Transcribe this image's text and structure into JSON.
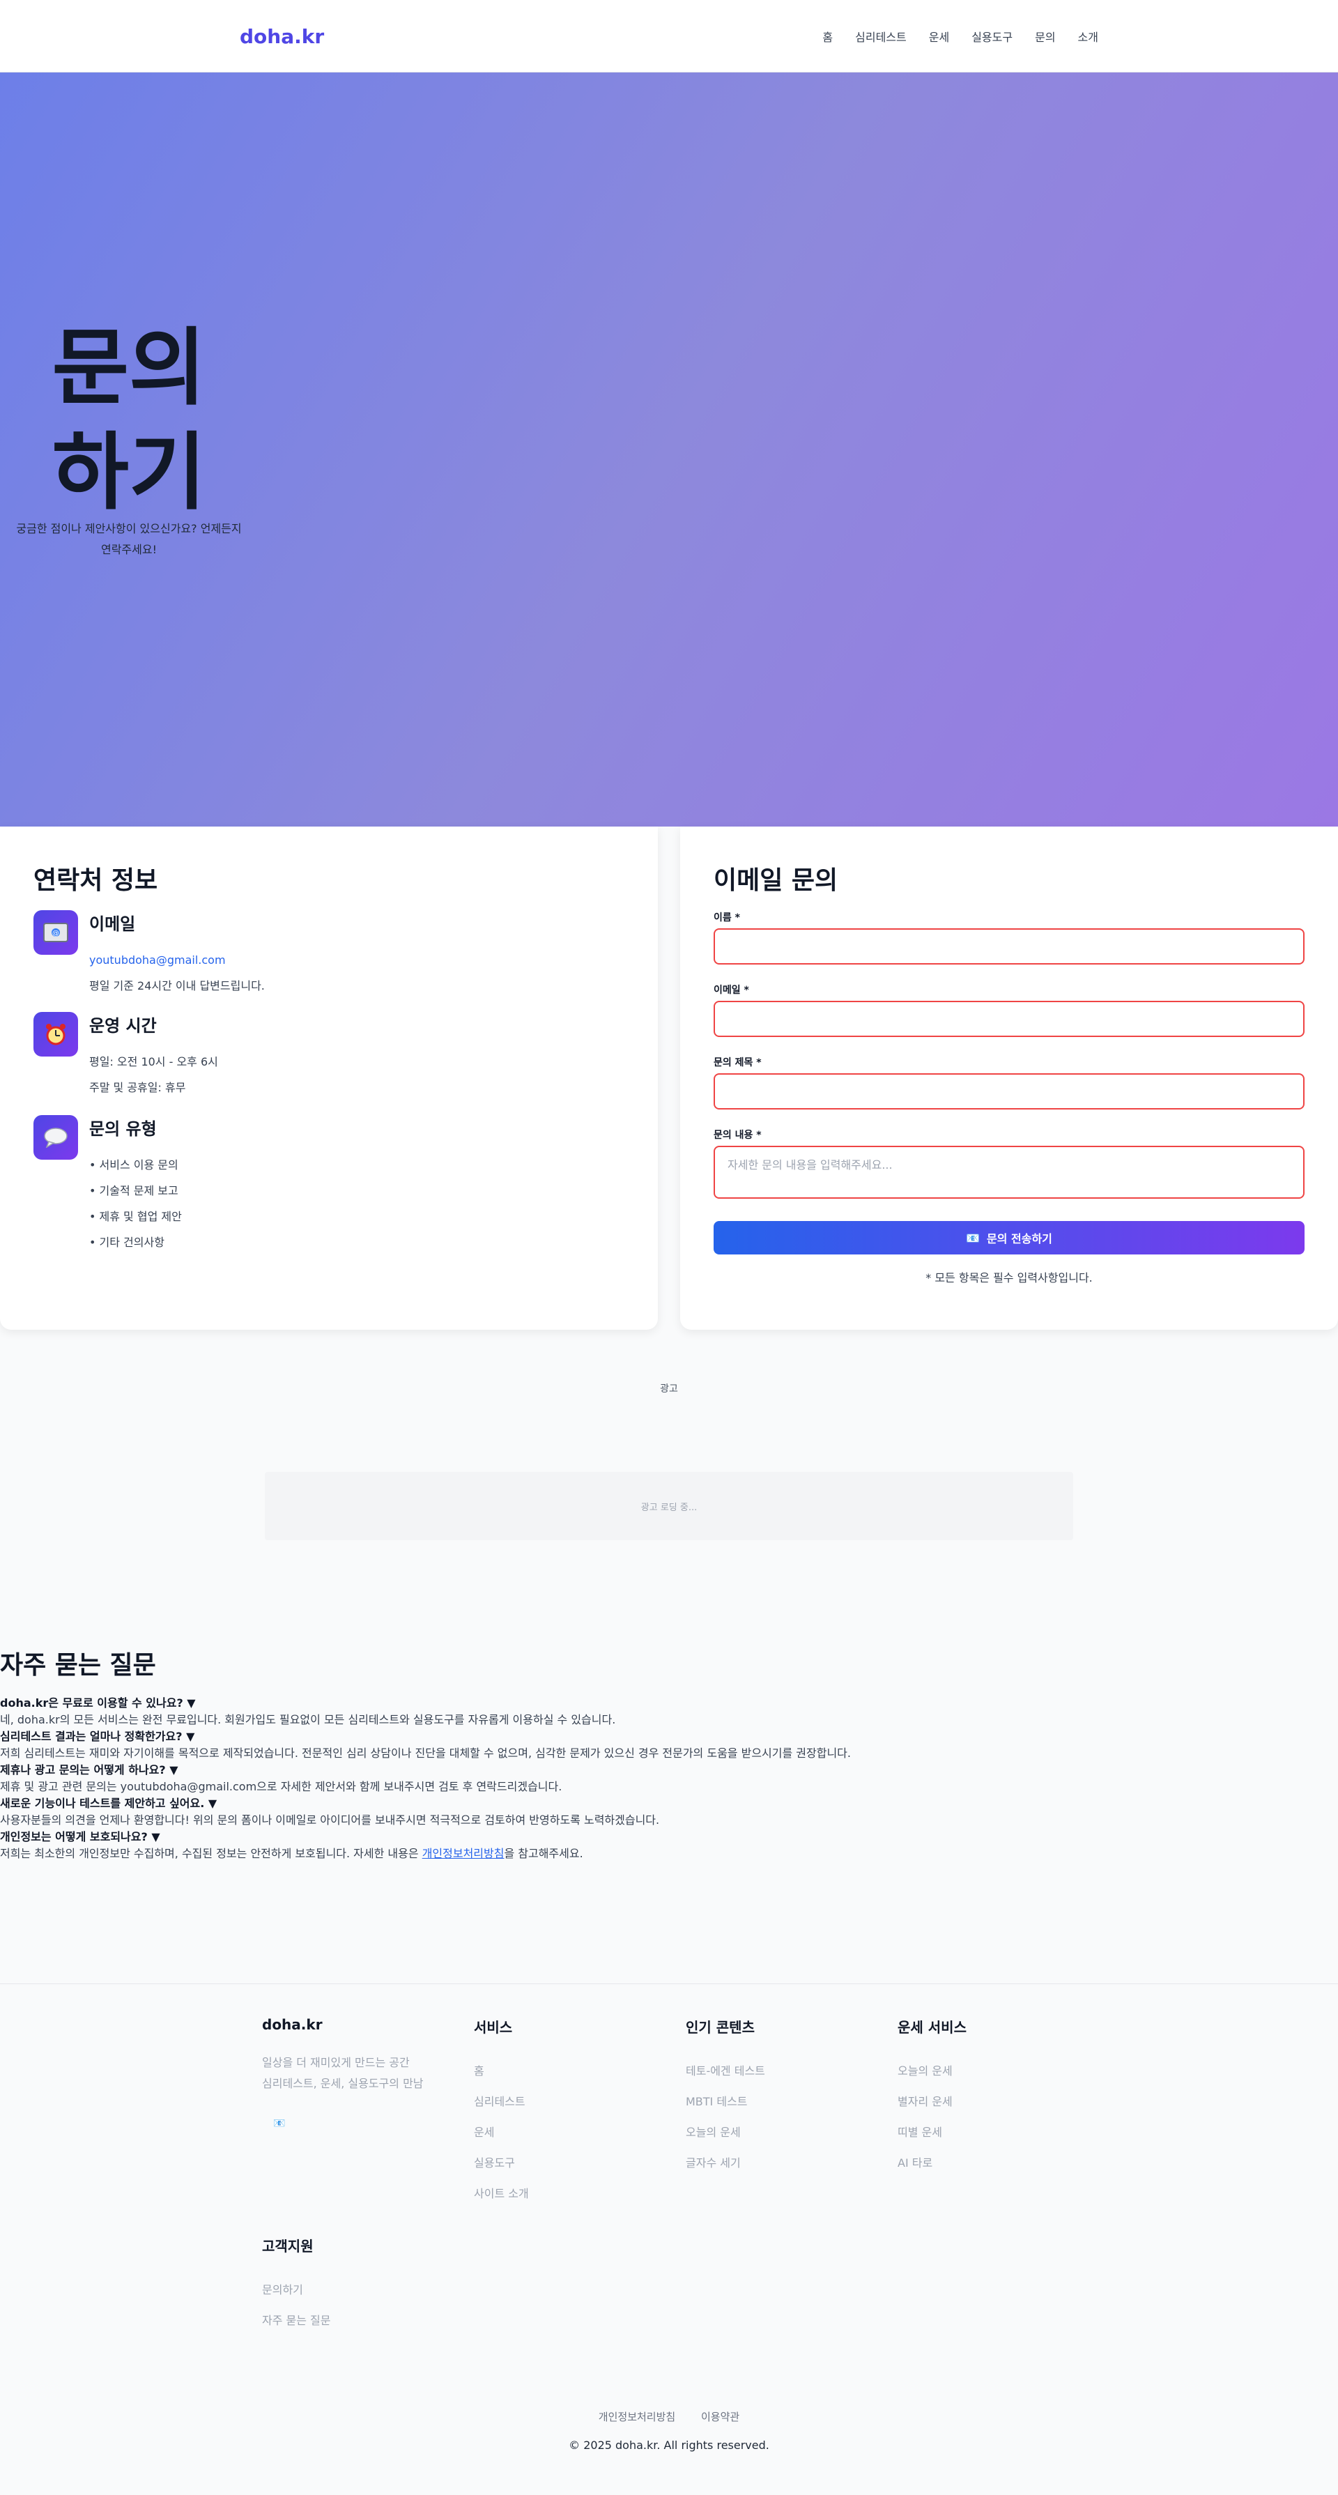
{
  "header": {
    "logo": "doha.kr",
    "nav": [
      "홈",
      "심리테스트",
      "운세",
      "실용도구",
      "문의",
      "소개"
    ]
  },
  "hero": {
    "title": "문의하기",
    "subtitle": "궁금한 점이나 제안사항이 있으신가요? 언제든지 연락주세요!"
  },
  "contact": {
    "heading": "연락처 정보",
    "email": {
      "icon": "email-icon",
      "title": "이메일",
      "address": "youtubdoha@gmail.com",
      "note": "평일 기준 24시간 이내 답변드립니다."
    },
    "hours": {
      "icon": "alarm-clock-icon",
      "title": "운영 시간",
      "weekday": "평일: 오전 10시 - 오후 6시",
      "weekend": "주말 및 공휴일: 휴무"
    },
    "types": {
      "icon": "speech-bubble-icon",
      "title": "문의 유형",
      "items": [
        "• 서비스 이용 문의",
        "• 기술적 문제 보고",
        "• 제휴 및 협업 제안",
        "• 기타 건의사항"
      ]
    }
  },
  "form": {
    "heading": "이메일 문의",
    "name_label": "이름 *",
    "name_value": "",
    "email_label": "이메일 *",
    "email_value": "",
    "subject_label": "문의 제목 *",
    "subject_value": "",
    "message_label": "문의 내용 *",
    "message_placeholder": "자세한 문의 내용을 입력해주세요...",
    "submit_icon": "📧",
    "submit_label": "문의 전송하기",
    "note": "* 모든 항목은 필수 입력사항입니다."
  },
  "ad": {
    "label": "광고",
    "loading": "광고 로딩 중..."
  },
  "faq": {
    "title": "자주 묻는 질문",
    "items": [
      {
        "q": "doha.kr은 무료로 이용할 수 있나요? ▼",
        "a": "네, doha.kr의 모든 서비스는 완전 무료입니다. 회원가입도 필요없이 모든 심리테스트와 실용도구를 자유롭게 이용하실 수 있습니다."
      },
      {
        "q": "심리테스트 결과는 얼마나 정확한가요? ▼",
        "a": "저희 심리테스트는 재미와 자기이해를 목적으로 제작되었습니다. 전문적인 심리 상담이나 진단을 대체할 수 없으며, 심각한 문제가 있으신 경우 전문가의 도움을 받으시기를 권장합니다."
      },
      {
        "q": "제휴나 광고 문의는 어떻게 하나요? ▼",
        "a": "제휴 및 광고 관련 문의는 youtubdoha@gmail.com으로 자세한 제안서와 함께 보내주시면 검토 후 연락드리겠습니다."
      },
      {
        "q": "새로운 기능이나 테스트를 제안하고 싶어요. ▼",
        "a": "사용자분들의 의견을 언제나 환영합니다! 위의 문의 폼이나 이메일로 아이디어를 보내주시면 적극적으로 검토하여 반영하도록 노력하겠습니다."
      },
      {
        "q": "개인정보는 어떻게 보호되나요? ▼",
        "a_prefix": "저희는 최소한의 개인정보만 수집하며, 수집된 정보는 안전하게 보호됩니다. 자세한 내용은 ",
        "a_link": "개인정보처리방침",
        "a_suffix": "을 참고해주세요."
      }
    ]
  },
  "footer": {
    "brand": {
      "name": "doha.kr",
      "line1": "일상을 더 재미있게 만드는 공간",
      "line2": "심리테스트, 운세, 실용도구의 만남",
      "badge": "📧"
    },
    "services": {
      "title": "서비스",
      "links": [
        "홈",
        "심리테스트",
        "운세",
        "실용도구",
        "사이트 소개"
      ]
    },
    "popular": {
      "title": "인기 콘텐츠",
      "links": [
        "테토-에겐 테스트",
        "MBTI 테스트",
        "오늘의 운세",
        "글자수 세기"
      ]
    },
    "fortune": {
      "title": "운세 서비스",
      "links": [
        "오늘의 운세",
        "별자리 운세",
        "띠별 운세",
        "AI 타로"
      ]
    },
    "support": {
      "title": "고객지원",
      "links": [
        "문의하기",
        "자주 묻는 질문"
      ]
    },
    "bottom": {
      "privacy": "개인정보처리방침",
      "terms": "이용약관",
      "copyright": "© 2025 doha.kr. All rights reserved."
    }
  }
}
